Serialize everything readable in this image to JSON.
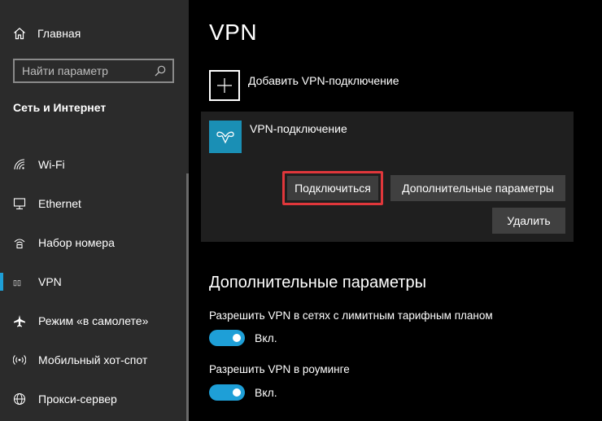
{
  "sidebar": {
    "home_label": "Главная",
    "search_placeholder": "Найти параметр",
    "section_title": "Сеть и Интернет",
    "items": [
      {
        "label": "Wi-Fi",
        "icon": "wifi-icon"
      },
      {
        "label": "Ethernet",
        "icon": "ethernet-icon"
      },
      {
        "label": "Набор номера",
        "icon": "dialup-icon"
      },
      {
        "label": "VPN",
        "icon": "vpn-icon",
        "active": true
      },
      {
        "label": "Режим «в самолете»",
        "icon": "airplane-icon"
      },
      {
        "label": "Мобильный хот-спот",
        "icon": "hotspot-icon"
      },
      {
        "label": "Прокси-сервер",
        "icon": "globe-icon"
      }
    ]
  },
  "main": {
    "title": "VPN",
    "add_vpn_label": "Добавить VPN-подключение",
    "connection": {
      "name": "VPN-подключение",
      "connect_label": "Подключиться",
      "advanced_label": "Дополнительные параметры",
      "delete_label": "Удалить"
    },
    "advanced": {
      "title": "Дополнительные параметры",
      "settings": [
        {
          "label": "Разрешить VPN в сетях с лимитным тарифным планом",
          "state": "Вкл.",
          "on": true
        },
        {
          "label": "Разрешить VPN в роуминге",
          "state": "Вкл.",
          "on": true
        }
      ]
    }
  },
  "colors": {
    "accent": "#1e9fd7",
    "highlight": "#e0373b",
    "sidebar_bg": "#2b2b2b",
    "panel_bg": "#1f1f1f"
  }
}
